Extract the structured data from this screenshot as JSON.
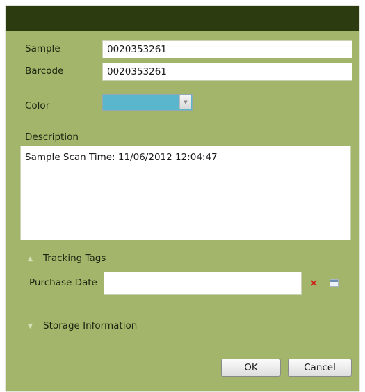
{
  "form": {
    "sample_label": "Sample",
    "sample_value": "0020353261",
    "barcode_label": "Barcode",
    "barcode_value": "0020353261",
    "color_label": "Color",
    "color_value": "#5ab6cd",
    "description_label": "Description",
    "description_value": "Sample Scan Time: 11/06/2012 12:04:47"
  },
  "tracking": {
    "header": "Tracking Tags",
    "expanded": true,
    "purchase_date_label": "Purchase Date",
    "purchase_date_value": ""
  },
  "storage": {
    "header": "Storage Information",
    "expanded": false
  },
  "buttons": {
    "ok": "OK",
    "cancel": "Cancel"
  },
  "icons": {
    "clear": "clear-x-icon",
    "calendar": "calendar-icon",
    "collapse": "chevron-up-icon",
    "expand": "chevron-down-icon",
    "dropdown": "dropdown-arrow-icon"
  },
  "colors": {
    "title_bar": "#2c3c10",
    "dialog_background": "#a3b56a",
    "clear_icon": "#d11a1a"
  }
}
